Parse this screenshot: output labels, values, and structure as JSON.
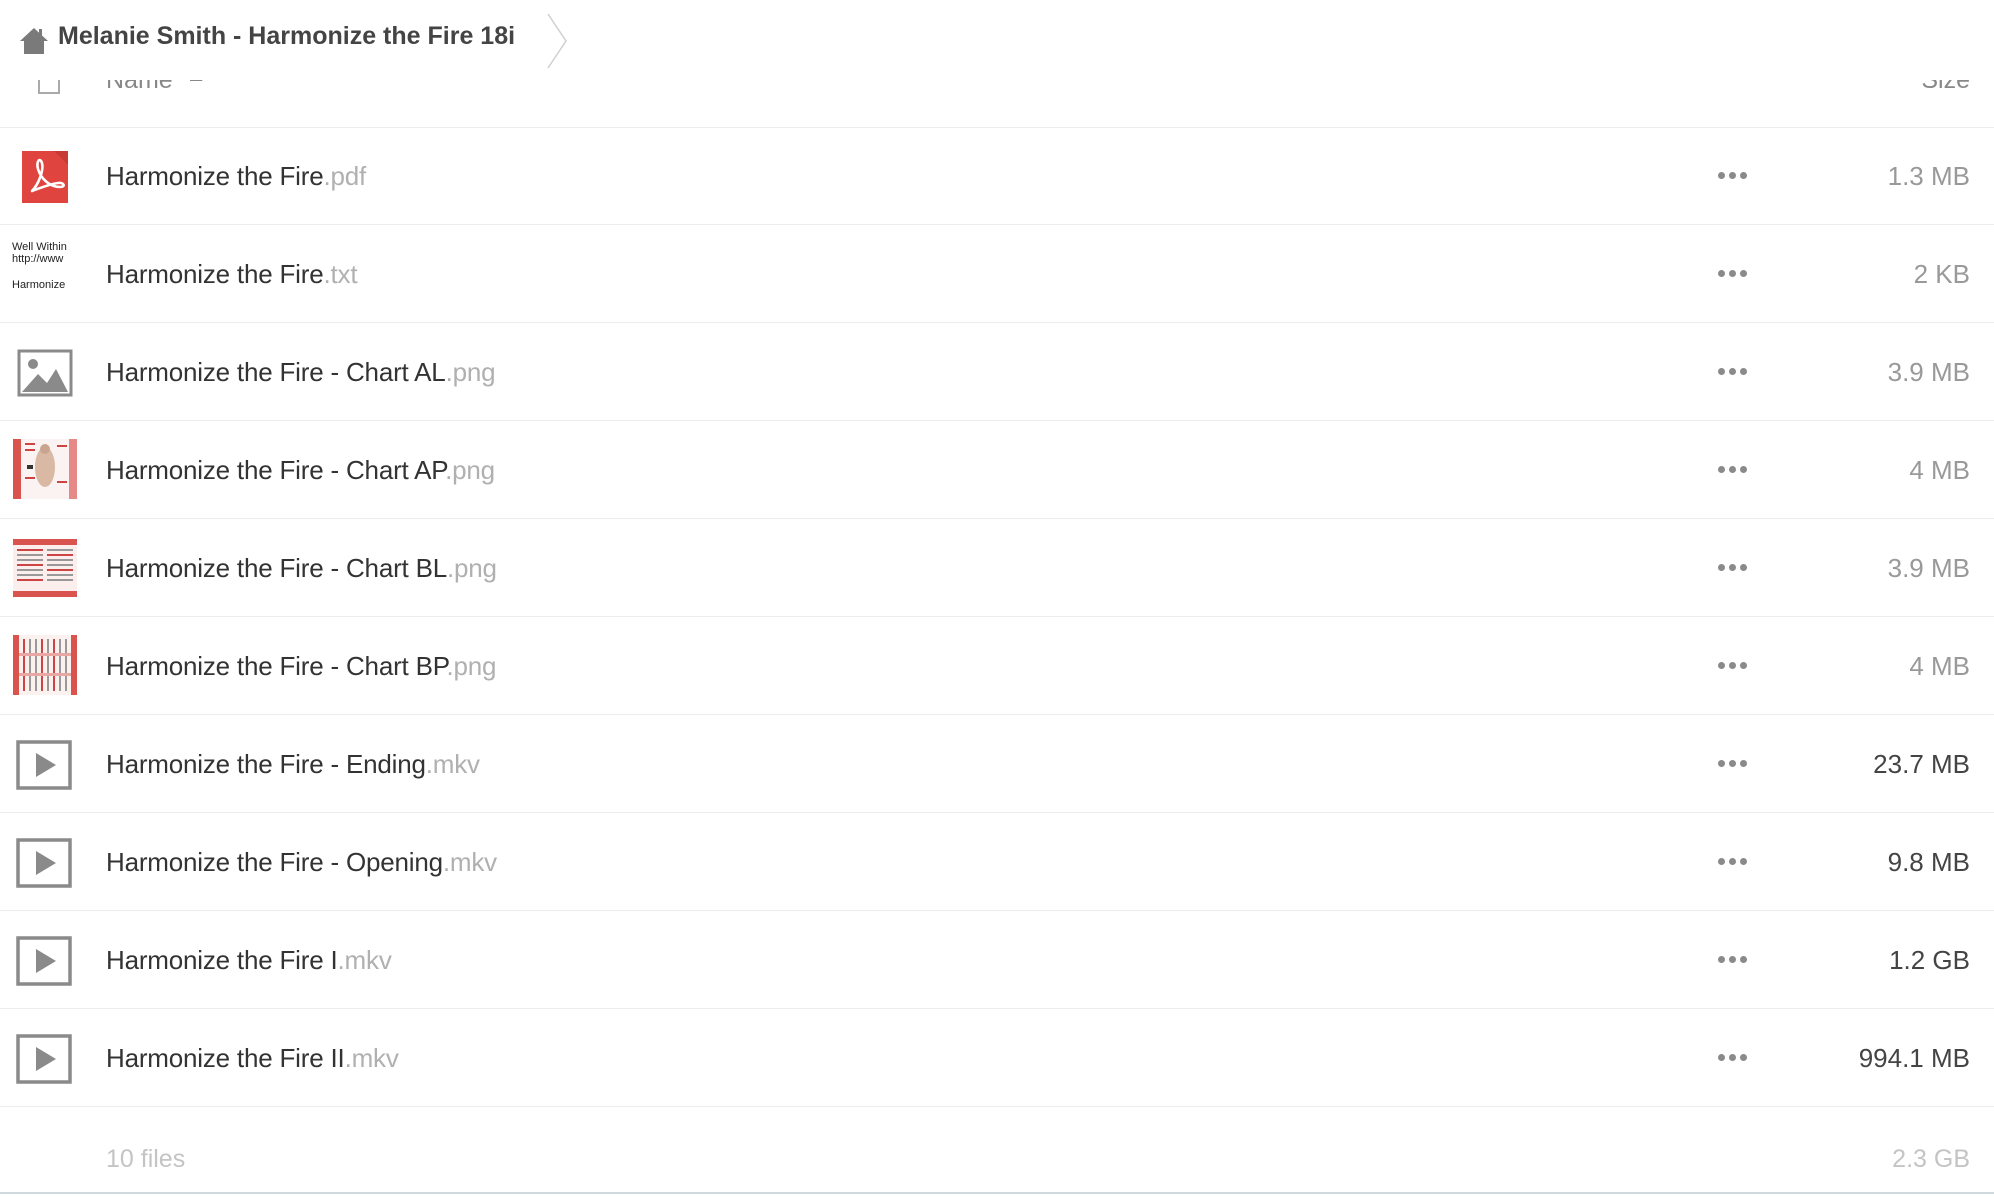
{
  "breadcrumb": {
    "title": "Melanie Smith - Harmonize the Fire 18i"
  },
  "header": {
    "name_label": "Name",
    "sort_indicator": "–",
    "size_label": "Size"
  },
  "files": [
    {
      "name": "Harmonize the Fire",
      "ext": ".pdf",
      "size": "1.3 MB",
      "icon": "pdf-icon"
    },
    {
      "name": "Harmonize the Fire",
      "ext": ".txt",
      "size": "2 KB",
      "icon": "text-preview-thumbnail",
      "preview_lines": [
        "Well Within",
        "http://www",
        "Harmonize"
      ]
    },
    {
      "name": "Harmonize the Fire - Chart AL",
      "ext": ".png",
      "size": "3.9 MB",
      "icon": "image-icon"
    },
    {
      "name": "Harmonize the Fire - Chart AP",
      "ext": ".png",
      "size": "4 MB",
      "icon": "chart-thumbnail"
    },
    {
      "name": "Harmonize the Fire - Chart BL",
      "ext": ".png",
      "size": "3.9 MB",
      "icon": "chart-thumbnail"
    },
    {
      "name": "Harmonize the Fire - Chart BP",
      "ext": ".png",
      "size": "4 MB",
      "icon": "chart-thumbnail"
    },
    {
      "name": "Harmonize the Fire - Ending",
      "ext": ".mkv",
      "size": "23.7 MB",
      "icon": "video-icon"
    },
    {
      "name": "Harmonize the Fire - Opening",
      "ext": ".mkv",
      "size": "9.8 MB",
      "icon": "video-icon"
    },
    {
      "name": "Harmonize the Fire I",
      "ext": ".mkv",
      "size": "1.2 GB",
      "icon": "video-icon"
    },
    {
      "name": "Harmonize the Fire II",
      "ext": ".mkv",
      "size": "994.1 MB",
      "icon": "video-icon"
    }
  ],
  "summary": {
    "count": "10 files",
    "total_size": "2.3 GB"
  },
  "colors": {
    "pdf_red": "#e0443e",
    "icon_gray": "#8a8a8a",
    "ext_gray": "#b0b0b0"
  }
}
